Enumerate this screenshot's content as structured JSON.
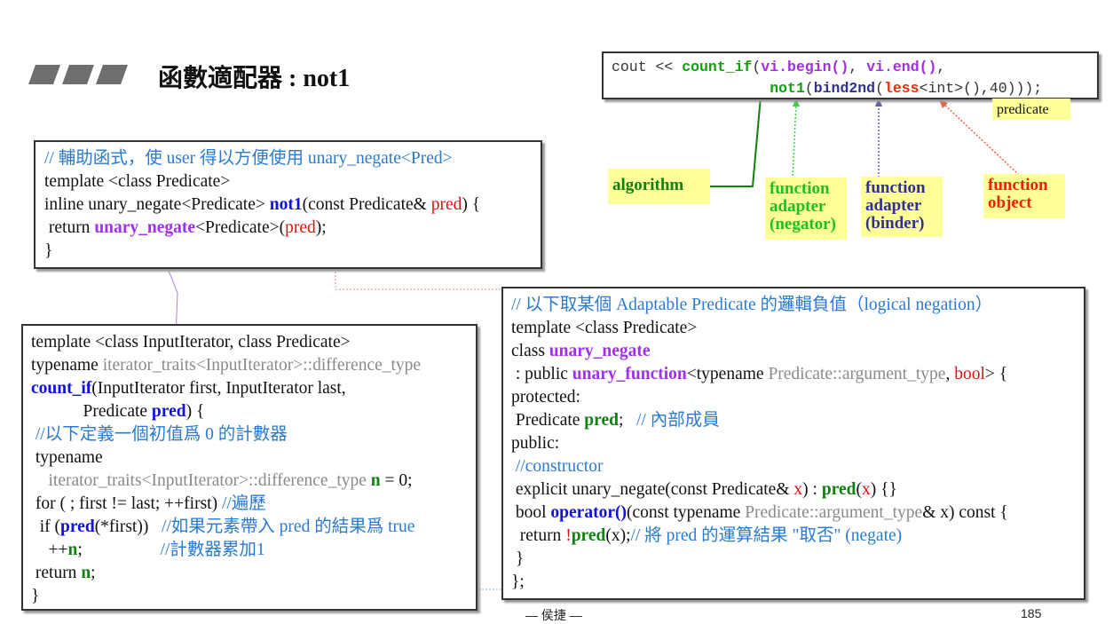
{
  "header": {
    "title": "函數適配器 : not1"
  },
  "top_code": {
    "lines": [
      [
        {
          "t": "cout << ",
          "c": "m-k"
        },
        {
          "t": "count_if",
          "c": "m-gr"
        },
        {
          "t": "(",
          "c": "m-k"
        },
        {
          "t": "vi.begin()",
          "c": "m-p"
        },
        {
          "t": ", ",
          "c": "m-k"
        },
        {
          "t": "vi.end()",
          "c": "m-p"
        },
        {
          "t": ",",
          "c": "m-k"
        }
      ],
      [
        {
          "t": "                  ",
          "c": "m-k"
        },
        {
          "t": "not1",
          "c": "m-gr"
        },
        {
          "t": "(",
          "c": "m-k"
        },
        {
          "t": "bind2nd",
          "c": "m-n"
        },
        {
          "t": "(",
          "c": "m-k"
        },
        {
          "t": "less",
          "c": "m-r"
        },
        {
          "t": "<int>(),40)));",
          "c": "m-k"
        }
      ]
    ]
  },
  "labels": {
    "predicate": "predicate",
    "algorithm": "algorithm",
    "negator": "function adapter (negator)",
    "binder": "function adapter (binder)",
    "function_object": "function object"
  },
  "colors": {
    "algorithm": "#108010",
    "negator": "#20c020",
    "binder": "#303090",
    "function_object": "#f02000",
    "label_bg": "#ffff99"
  },
  "not1_box": {
    "lines": [
      [
        {
          "t": "// 輔助函式，使 user 得以方便使用 unary_negate<Pred>",
          "c": "c"
        }
      ],
      [
        {
          "t": "template <class Predicate>",
          "c": "k"
        }
      ],
      [
        {
          "t": "inline unary_negate<Predicate> ",
          "c": "k"
        },
        {
          "t": "not1",
          "c": "b"
        },
        {
          "t": "(const Predicate& ",
          "c": "k"
        },
        {
          "t": "pred",
          "c": "r"
        },
        {
          "t": ") {",
          "c": "k"
        }
      ],
      [
        {
          "t": " return ",
          "c": "k"
        },
        {
          "t": "unary_negate",
          "c": "p"
        },
        {
          "t": "<Predicate>(",
          "c": "k"
        },
        {
          "t": "pred",
          "c": "r"
        },
        {
          "t": ");",
          "c": "k"
        }
      ],
      [
        {
          "t": "}",
          "c": "k"
        }
      ]
    ]
  },
  "count_if_box": {
    "lines": [
      [
        {
          "t": "template <class InputIterator, class Predicate>",
          "c": "k"
        }
      ],
      [
        {
          "t": "typename ",
          "c": "k"
        },
        {
          "t": "iterator_traits<InputIterator>::difference_type",
          "c": "g"
        }
      ],
      [
        {
          "t": "count_if",
          "c": "b"
        },
        {
          "t": "(InputIterator first, InputIterator last,",
          "c": "k"
        }
      ],
      [
        {
          "t": "            Predicate ",
          "c": "k"
        },
        {
          "t": "pred",
          "c": "b"
        },
        {
          "t": ") {",
          "c": "k"
        }
      ],
      [
        {
          "t": " //以下定義一個初值爲 0 的計數器",
          "c": "c"
        }
      ],
      [
        {
          "t": " typename",
          "c": "k"
        }
      ],
      [
        {
          "t": "    iterator_traits<InputIterator>::difference_type ",
          "c": "g"
        },
        {
          "t": "n",
          "c": "gr"
        },
        {
          "t": " = 0;",
          "c": "k"
        }
      ],
      [
        {
          "t": " for ( ; first != last; ++first) ",
          "c": "k"
        },
        {
          "t": "//遍歷",
          "c": "c"
        }
      ],
      [
        {
          "t": "  if (",
          "c": "k"
        },
        {
          "t": "pred",
          "c": "b"
        },
        {
          "t": "(*first))   ",
          "c": "k"
        },
        {
          "t": "//如果元素帶入 pred 的結果爲 true",
          "c": "c"
        }
      ],
      [
        {
          "t": "    ++",
          "c": "k"
        },
        {
          "t": "n",
          "c": "gr"
        },
        {
          "t": ";                  ",
          "c": "k"
        },
        {
          "t": "//計數器累加1",
          "c": "c"
        }
      ],
      [
        {
          "t": " return ",
          "c": "k"
        },
        {
          "t": "n",
          "c": "gr"
        },
        {
          "t": ";",
          "c": "k"
        }
      ],
      [
        {
          "t": "}",
          "c": "k"
        }
      ]
    ]
  },
  "unary_negate_box": {
    "lines": [
      [
        {
          "t": "// 以下取某個 Adaptable Predicate 的邏輯負值（logical negation）",
          "c": "c"
        }
      ],
      [
        {
          "t": "template <class Predicate>",
          "c": "k"
        }
      ],
      [
        {
          "t": "class ",
          "c": "k"
        },
        {
          "t": "unary_negate",
          "c": "p"
        }
      ],
      [
        {
          "t": " : public ",
          "c": "k"
        },
        {
          "t": "unary_function",
          "c": "p"
        },
        {
          "t": "<typename ",
          "c": "k"
        },
        {
          "t": "Predicate::argument_type",
          "c": "g"
        },
        {
          "t": ", ",
          "c": "k"
        },
        {
          "t": "bool",
          "c": "r"
        },
        {
          "t": "> {",
          "c": "k"
        }
      ],
      [
        {
          "t": "protected:",
          "c": "k"
        }
      ],
      [
        {
          "t": " Predicate ",
          "c": "k"
        },
        {
          "t": "pred",
          "c": "gr"
        },
        {
          "t": ";   ",
          "c": "k"
        },
        {
          "t": "// 內部成員",
          "c": "c"
        }
      ],
      [
        {
          "t": "public:",
          "c": "k"
        }
      ],
      [
        {
          "t": " //constructor",
          "c": "c"
        }
      ],
      [
        {
          "t": " explicit unary_negate(const Predicate& ",
          "c": "k"
        },
        {
          "t": "x",
          "c": "r"
        },
        {
          "t": ") : ",
          "c": "k"
        },
        {
          "t": "pred",
          "c": "gr"
        },
        {
          "t": "(",
          "c": "k"
        },
        {
          "t": "x",
          "c": "r"
        },
        {
          "t": ") {}",
          "c": "k"
        }
      ],
      [
        {
          "t": " bool ",
          "c": "k"
        },
        {
          "t": "operator()",
          "c": "b"
        },
        {
          "t": "(const typename ",
          "c": "k"
        },
        {
          "t": "Predicate::argument_type",
          "c": "g"
        },
        {
          "t": "& x) const {",
          "c": "k"
        }
      ],
      [
        {
          "t": "  return ",
          "c": "k"
        },
        {
          "t": "!",
          "c": "r"
        },
        {
          "t": "pred",
          "c": "gr"
        },
        {
          "t": "(x);",
          "c": "k"
        },
        {
          "t": "// 將 pred 的運算結果 \"取否\" (negate)",
          "c": "c"
        }
      ],
      [
        {
          "t": " }",
          "c": "k"
        }
      ],
      [
        {
          "t": "};",
          "c": "k"
        }
      ]
    ]
  },
  "footer": {
    "author": "— 侯捷 —",
    "page": "185"
  }
}
